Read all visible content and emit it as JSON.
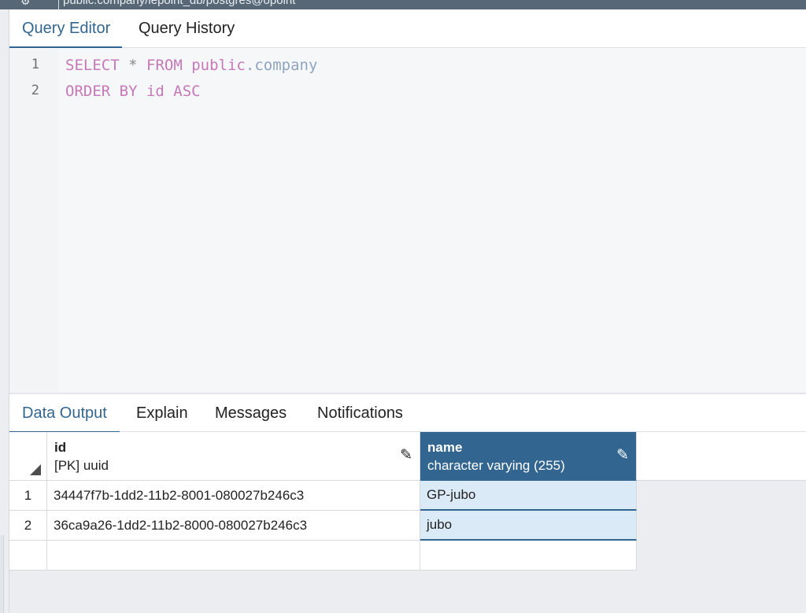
{
  "window": {
    "title": "public.company/iepoint_db/postgres@opoint"
  },
  "editor_tabs": [
    {
      "label": "Query Editor",
      "active": true
    },
    {
      "label": "Query History",
      "active": false
    }
  ],
  "editor": {
    "line_numbers": [
      "1",
      "2"
    ],
    "line1": {
      "kw1": "SELECT",
      "op": "*",
      "kw2": "FROM",
      "schema": "public",
      "dot": ".",
      "table": "company"
    },
    "line2": {
      "text": "ORDER BY id ASC"
    }
  },
  "output_tabs": [
    {
      "label": "Data Output",
      "active": true
    },
    {
      "label": "Explain",
      "active": false
    },
    {
      "label": "Messages",
      "active": false
    },
    {
      "label": "Notifications",
      "active": false
    }
  ],
  "grid": {
    "columns": [
      {
        "name": "id",
        "type": "[PK] uuid",
        "selected": false,
        "icon": "pencil-icon"
      },
      {
        "name": "name",
        "type": "character varying (255)",
        "selected": true,
        "icon": "pencil-icon"
      }
    ],
    "rows": [
      {
        "row_number": "1",
        "id": "34447f7b-1dd2-11b2-8001-080027b246c3",
        "name": "GP-jubo"
      },
      {
        "row_number": "2",
        "id": "36ca9a26-1dd2-11b2-8000-080027b246c3",
        "name": "jubo"
      }
    ]
  },
  "colors": {
    "accent": "#326690",
    "keyword": "#c678b9",
    "table": "#8fa4bf",
    "selected_cell": "#daeaf7"
  }
}
